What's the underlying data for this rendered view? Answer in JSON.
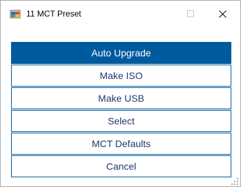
{
  "window": {
    "title": "11 MCT Preset",
    "app_icon": "windows-app-icon",
    "controls": {
      "minimize": "minimize-icon",
      "maximize": "maximize-icon",
      "close": "close-icon"
    }
  },
  "buttons": [
    {
      "label": "Auto Upgrade",
      "primary": true
    },
    {
      "label": "Make ISO",
      "primary": false
    },
    {
      "label": "Make USB",
      "primary": false
    },
    {
      "label": "Select",
      "primary": false
    },
    {
      "label": "MCT Defaults",
      "primary": false
    },
    {
      "label": "Cancel",
      "primary": false
    }
  ],
  "colors": {
    "accent": "#005a9e",
    "button_text": "#1e3c6e",
    "window_bg": "#ffffff"
  }
}
